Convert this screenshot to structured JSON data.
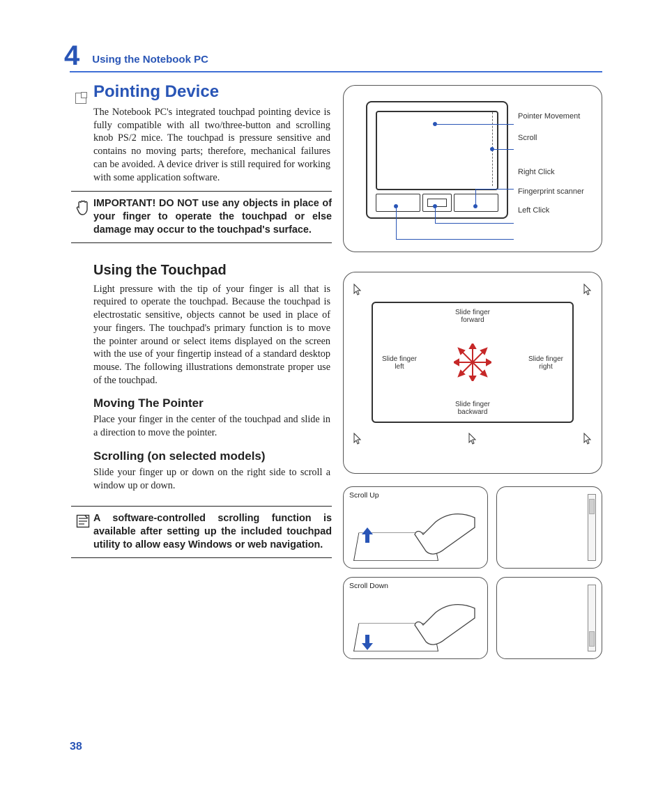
{
  "page_number": "38",
  "chapter": {
    "number": "4",
    "title": "Using the Notebook PC"
  },
  "sections": {
    "pointing_device": {
      "heading": "Pointing Device",
      "body": "The Notebook PC's integrated touchpad pointing device is fully compatible with all two/three-button and scrolling knob PS/2 mice. The touchpad is pressure sensitive and contains no moving parts; therefore, mechanical failures can be avoided. A device driver is still required for working with some application software."
    },
    "important_callout": "IMPORTANT! DO NOT use any objects in place of your finger to operate the touchpad or else damage may occur to the touchpad's surface.",
    "using_touchpad": {
      "heading": "Using the Touchpad",
      "body": "Light pressure with the tip of your finger is all that is required to operate the touchpad. Because the touchpad is electrostatic sensitive, objects cannot be used in place of your fingers. The touchpad's primary function is to move the pointer around or select items displayed on the screen with the use of your fingertip instead of a standard desktop mouse. The following illustrations demonstrate proper use of the touchpad."
    },
    "moving_pointer": {
      "heading": "Moving The Pointer",
      "body": "Place your finger in the center of the touchpad and slide in a direction to move the pointer."
    },
    "scrolling": {
      "heading": "Scrolling (on selected models)",
      "body": "Slide your finger up or down on the right side to scroll a window up or down."
    },
    "note_callout": "A software-controlled scrolling function is available after setting up the included touchpad utility to allow easy Windows or web navigation."
  },
  "figures": {
    "touchpad_labels": {
      "pointer": "Pointer Movement",
      "scroll": "Scroll",
      "right_click": "Right Click",
      "fingerprint": "Fingerprint scanner",
      "left_click": "Left Click"
    },
    "slide_labels": {
      "forward": "Slide finger forward",
      "backward": "Slide finger backward",
      "left": "Slide finger left",
      "right": "Slide finger right"
    },
    "scroll_labels": {
      "up": "Scroll Up",
      "down": "Scroll Down"
    }
  }
}
